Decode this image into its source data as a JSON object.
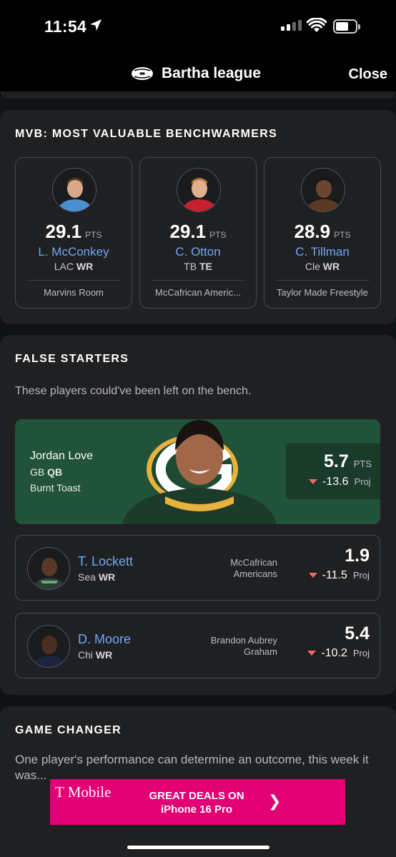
{
  "status_bar": {
    "time": "11:54"
  },
  "nav": {
    "title": "Bartha league",
    "close_label": "Close"
  },
  "mvb": {
    "title": "MVB: MOST VALUABLE BENCHWARMERS",
    "players": [
      {
        "points": "29.1",
        "points_label": "PTS",
        "name": "L. McConkey",
        "team": "LAC",
        "position": "WR",
        "fantasy_team": "Marvins Room",
        "jersey_color": "#4a8fd0"
      },
      {
        "points": "29.1",
        "points_label": "PTS",
        "name": "C. Otton",
        "team": "TB",
        "position": "TE",
        "fantasy_team": "McCafrican Americ...",
        "jersey_color": "#c8202e"
      },
      {
        "points": "28.9",
        "points_label": "PTS",
        "name": "C. Tillman",
        "team": "Cle",
        "position": "WR",
        "fantasy_team": "Taylor Made Freestyle",
        "jersey_color": "#5a3a26"
      }
    ]
  },
  "false_starters": {
    "title": "FALSE STARTERS",
    "subtitle": "These players could've been left on the bench.",
    "featured": {
      "name": "Jordan Love",
      "team": "GB",
      "position": "QB",
      "fantasy_team": "Burnt Toast",
      "points": "5.7",
      "points_label": "PTS",
      "diff": "-13.6",
      "proj_label": "Proj"
    },
    "rows": [
      {
        "name": "T. Lockett",
        "team": "Sea",
        "position": "WR",
        "fantasy_team_line1": "McCafrican",
        "fantasy_team_line2": "Americans",
        "points": "1.9",
        "diff": "-11.5",
        "proj_label": "Proj"
      },
      {
        "name": "D. Moore",
        "team": "Chi",
        "position": "WR",
        "fantasy_team_line1": "Brandon Aubrey",
        "fantasy_team_line2": "Graham",
        "points": "5.4",
        "diff": "-10.2",
        "proj_label": "Proj"
      }
    ]
  },
  "game_changer": {
    "title": "GAME CHANGER",
    "body": "One player's performance can determine an outcome, this week it was..."
  },
  "ad": {
    "brand": "T Mobile",
    "line1": "GREAT DEALS ON",
    "line2": "iPhone 16 Pro",
    "arrow": "❯"
  },
  "colors": {
    "accent_link": "#6fa7f5",
    "negative": "#ee6a6a",
    "hero_green": "#20533a",
    "ad_magenta": "#e20074"
  }
}
